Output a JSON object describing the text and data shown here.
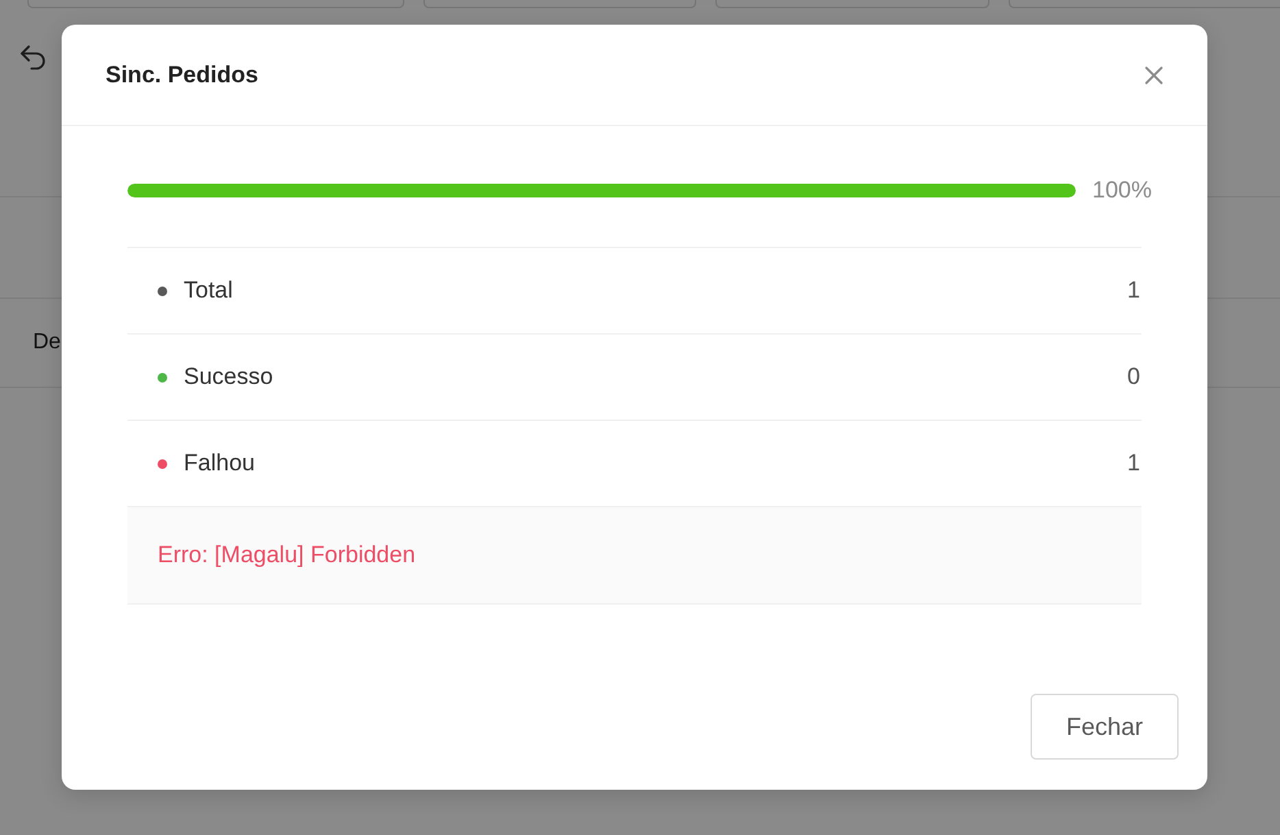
{
  "background": {
    "table": {
      "column_1": "De"
    }
  },
  "dialog": {
    "title": "Sinc. Pedidos",
    "progress": {
      "level": 1,
      "reading": "100%"
    },
    "stats": [
      {
        "label": "Total",
        "value": "1",
        "color": "#595959"
      },
      {
        "label": "Sucesso",
        "value": "0",
        "color": "#4db848"
      },
      {
        "label": "Falhou",
        "value": "1",
        "color": "#ee4d66"
      }
    ],
    "error": "Erro: [Magalu] Forbidden",
    "buttons": [
      "Fechar"
    ]
  }
}
